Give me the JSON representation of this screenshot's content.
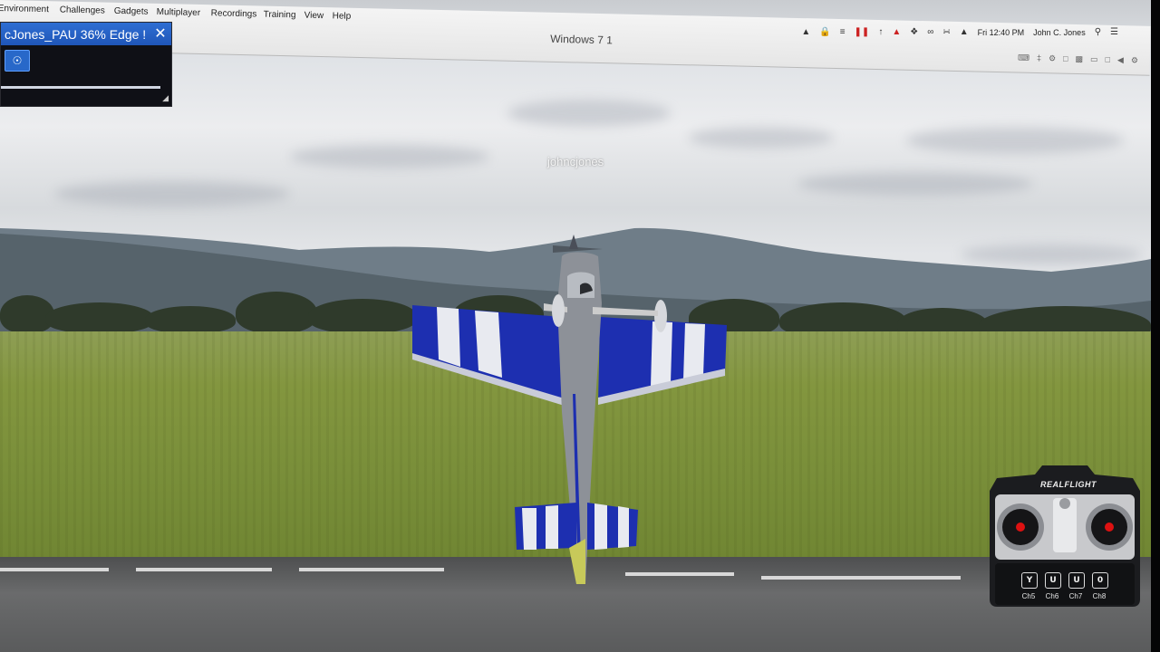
{
  "menubar": {
    "items": [
      {
        "label": "Environment"
      },
      {
        "label": "Challenges"
      },
      {
        "label": "Gadgets"
      },
      {
        "label": "Multiplayer"
      },
      {
        "label": "Recordings"
      },
      {
        "label": "Training"
      },
      {
        "label": "View"
      },
      {
        "label": "Help"
      }
    ],
    "window_title": "Windows 7 1",
    "clock": "Fri 12:40 PM",
    "user": "John C. Jones"
  },
  "floating_window": {
    "title": "cJones_PAU 36% Edge !",
    "close_icon": "close-icon",
    "button_icon": "eye-icon"
  },
  "scene": {
    "watermark": "johncjones",
    "colors": {
      "sky": "#e3e5e8",
      "grass": "#7a8f3a",
      "runway": "#5a5b5c",
      "wing_blue": "#1d2fb0"
    }
  },
  "transmitter": {
    "logo": "REALFLIGHT",
    "channels": [
      {
        "key": "Y",
        "label": "Ch5"
      },
      {
        "key": "U",
        "label": "Ch6"
      },
      {
        "key": "U",
        "label": "Ch7"
      },
      {
        "key": "0",
        "label": "Ch8"
      }
    ]
  }
}
